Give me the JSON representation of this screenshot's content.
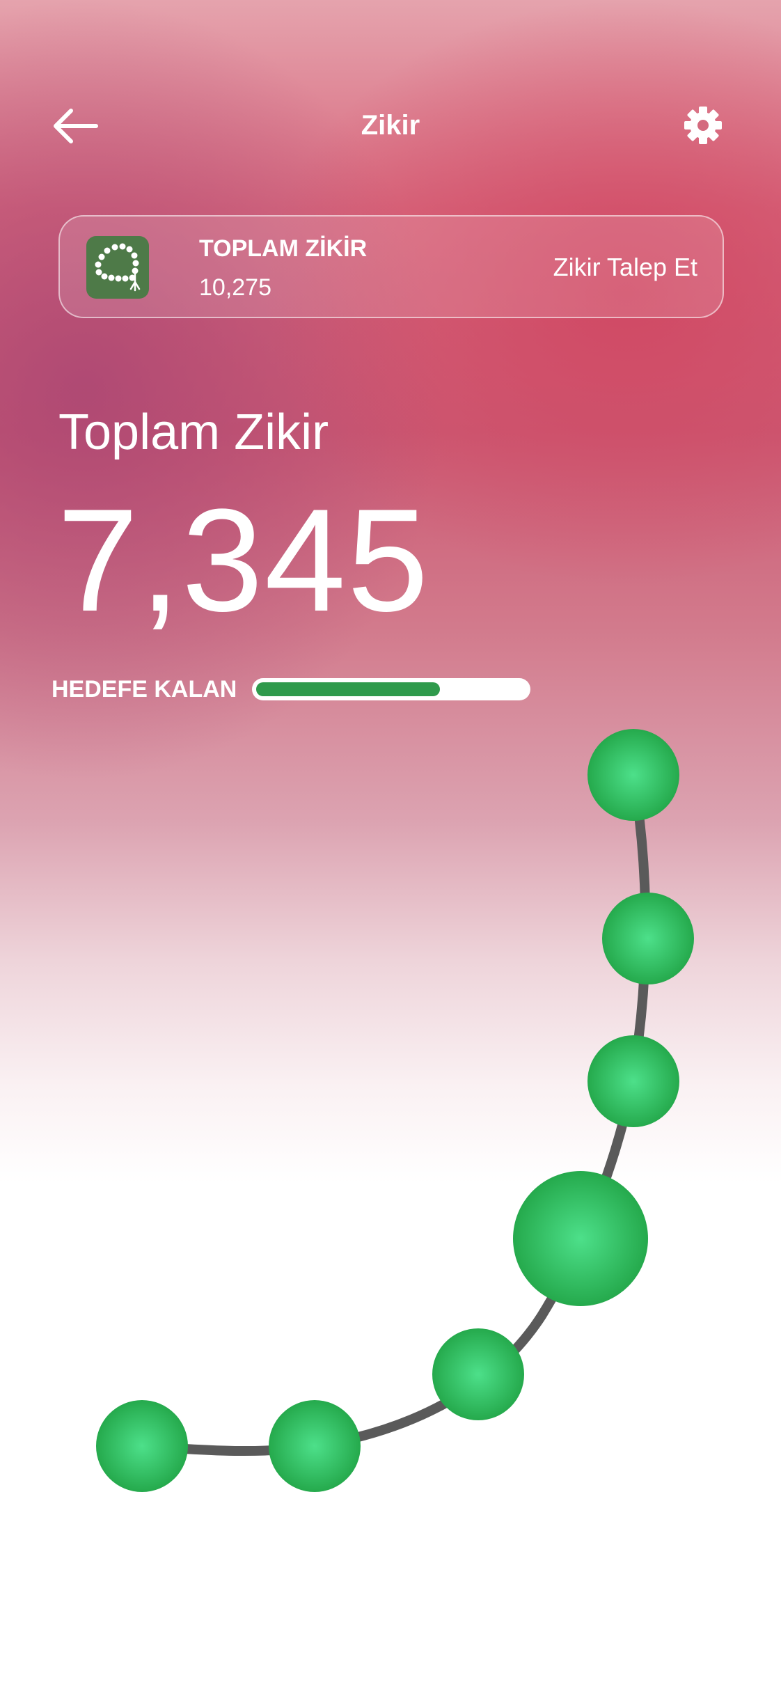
{
  "header": {
    "title": "Zikir",
    "back_icon": "arrow-left-icon",
    "settings_icon": "gear-icon"
  },
  "summary_card": {
    "icon": "prayer-beads-icon",
    "label": "TOPLAM ZİKİR",
    "value": "10,275",
    "action_label": "Zikir Talep Et"
  },
  "counter": {
    "label": "Toplam Zikir",
    "value": "7,345"
  },
  "goal": {
    "label": "HEDEFE KALAN",
    "progress": 0.68
  },
  "beads": {
    "count": 7,
    "string_color": "#5a5a5a",
    "bead_color_light": "#4de08a",
    "bead_color_dark": "#21a446"
  },
  "colors": {
    "accent_green": "#2f9a4c",
    "icon_tile": "#4e7a48",
    "background_top": "#d8697e"
  }
}
